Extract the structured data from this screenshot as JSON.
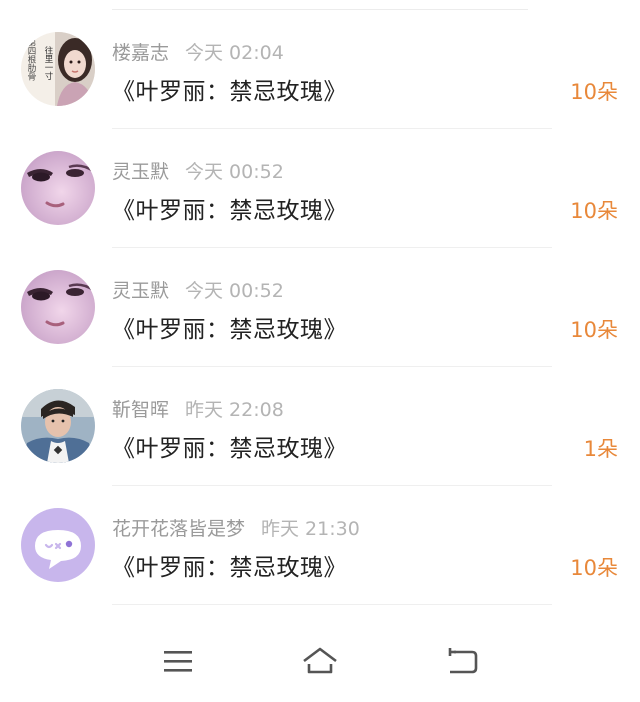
{
  "items": [
    {
      "name": "楼嘉志",
      "time": "今天 02:04",
      "title": "《叶罗丽：禁忌玫瑰》",
      "count": "10朵",
      "avatar_icon": "book-cover-girl-avatar",
      "avatar_text": "往里一寸",
      "avatar_text2": "第四根肋骨"
    },
    {
      "name": "灵玉默",
      "time": "今天 00:52",
      "title": "《叶罗丽：禁忌玫瑰》",
      "count": "10朵",
      "avatar_icon": "anime-face-avatar"
    },
    {
      "name": "灵玉默",
      "time": "今天 00:52",
      "title": "《叶罗丽：禁忌玫瑰》",
      "count": "10朵",
      "avatar_icon": "anime-face-avatar"
    },
    {
      "name": "靳智晖",
      "time": "昨天 22:08",
      "title": "《叶罗丽：禁忌玫瑰》",
      "count": "1朵",
      "avatar_icon": "boy-photo-avatar"
    },
    {
      "name": "花开花落皆是梦",
      "time": "昨天 21:30",
      "title": "《叶罗丽：禁忌玫瑰》",
      "count": "10朵",
      "avatar_icon": "default-chat-avatar"
    }
  ],
  "colors": {
    "count": "#e8883a",
    "name": "#9a9a9a",
    "title": "#222222",
    "default_avatar_bg": "#c8b6ec"
  },
  "navbar": {
    "icons": [
      "menu-icon",
      "home-icon",
      "back-icon"
    ]
  }
}
